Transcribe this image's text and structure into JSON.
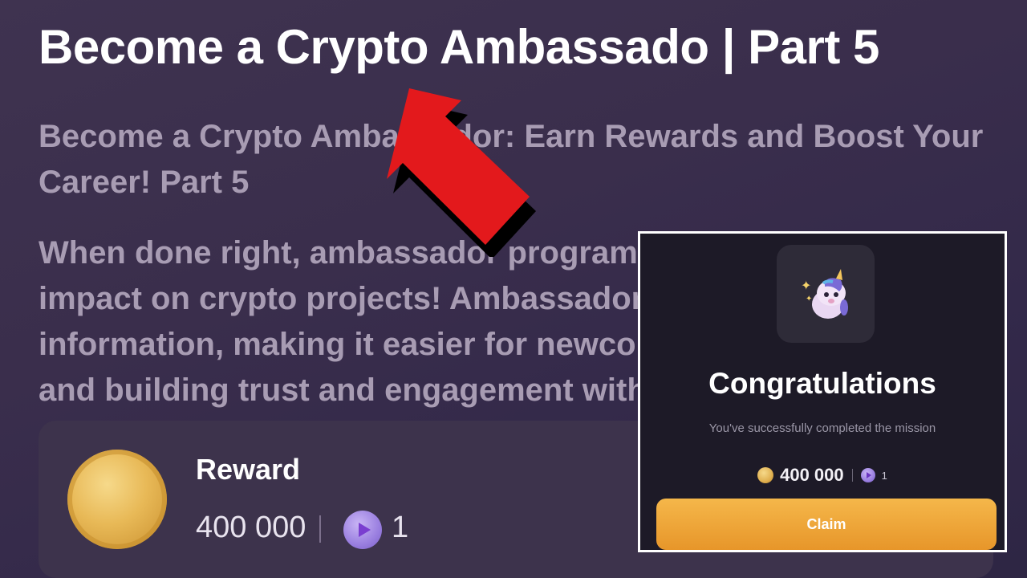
{
  "article": {
    "title": "Become a Crypto Ambassado | Part 5",
    "subtitle": "Become a Crypto Ambassador: Earn Rewards and Boost Your Career! Part 5",
    "body": "When done right, ambassador programs can have a great impact on crypto projects! Ambassadors help to spread information, making it easier for newcomers to get involved and building trust and engagement with the community."
  },
  "reward_card": {
    "label": "Reward",
    "amount": "400 000",
    "token_count": "1"
  },
  "popup": {
    "title": "Congratulations",
    "subtitle": "You've successfully completed the mission",
    "amount": "400 000",
    "token_count": "1",
    "claim_label": "Claim"
  },
  "colors": {
    "accent_orange": "#f0a83a",
    "arrow_red": "#e3191c",
    "background": "#3a2e4c",
    "coin_gold": "#e8b957",
    "token_purple": "#9a7fe0"
  },
  "icons": {
    "popup_icon": "unicorn-icon",
    "reward_coin": "coin-icon",
    "token": "play-token-icon"
  }
}
